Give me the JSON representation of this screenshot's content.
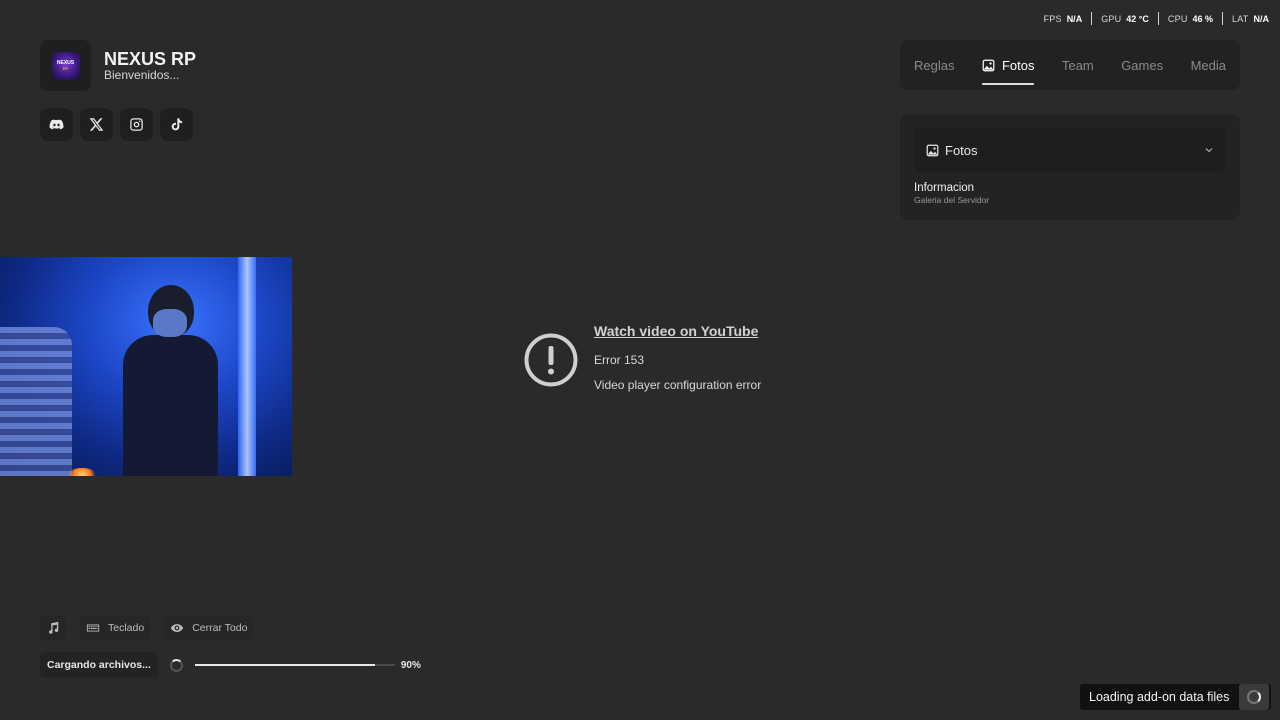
{
  "stats": [
    {
      "label": "FPS",
      "value": "N/A"
    },
    {
      "label": "GPU",
      "value": "42 °C"
    },
    {
      "label": "CPU",
      "value": "46 %"
    },
    {
      "label": "LAT",
      "value": "N/A"
    }
  ],
  "brand": {
    "logo_line1": "NEXUS",
    "logo_line2": "RP",
    "title": "NEXUS RP",
    "subtitle": "Bienvenidos..."
  },
  "socials": [
    "discord-icon",
    "x-icon",
    "instagram-icon",
    "tiktok-icon"
  ],
  "nav": {
    "tabs": [
      {
        "label": "Reglas",
        "active": false
      },
      {
        "label": "Fotos",
        "active": true,
        "icon": "image-icon"
      },
      {
        "label": "Team",
        "active": false
      },
      {
        "label": "Games",
        "active": false
      },
      {
        "label": "Media",
        "active": false
      }
    ]
  },
  "panel": {
    "select_label": "Fotos",
    "info_title": "Informacion",
    "info_subtitle": "Galeria del Servidor"
  },
  "video": {
    "link": "Watch video on YouTube",
    "error_code": "Error 153",
    "error_message": "Video player configuration error"
  },
  "controls": {
    "music_icon": "music-note-icon",
    "keyboard_label": "Teclado",
    "close_all_label": "Cerrar Todo"
  },
  "loading": {
    "label": "Cargando archivos...",
    "progress": 0.9,
    "percent_text": "90%"
  },
  "toast": {
    "text": "Loading add-on data files"
  }
}
